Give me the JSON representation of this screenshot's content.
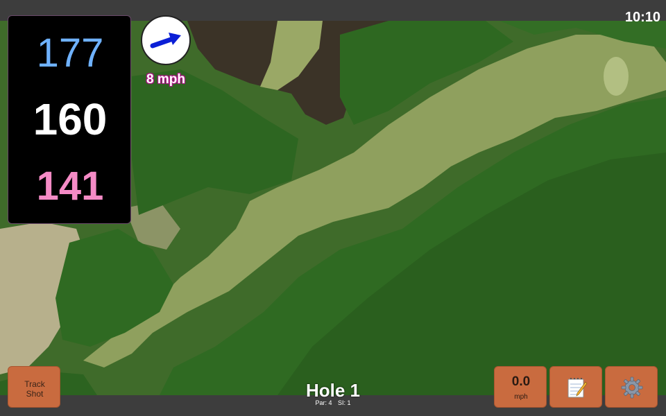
{
  "status": {
    "time": "10:10"
  },
  "distances": {
    "back": "177",
    "middle": "160",
    "front": "141"
  },
  "wind": {
    "speed_label": "8 mph",
    "direction_icon": "wind-arrow-icon"
  },
  "hole": {
    "title": "Hole 1",
    "par": "Par: 4",
    "si": "SI: 1"
  },
  "buttons": {
    "track_line1": "Track",
    "track_line2": "Shot",
    "speed_value": "0.0",
    "speed_unit": "mph",
    "notes_icon": "notepad-icon",
    "settings_icon": "gear-icon"
  },
  "colors": {
    "back_distance": "#6fb2ff",
    "middle_distance": "#ffffff",
    "front_distance": "#f58bc6",
    "button": "#c96b3f",
    "wind_arrow": "#0b1fd6"
  }
}
